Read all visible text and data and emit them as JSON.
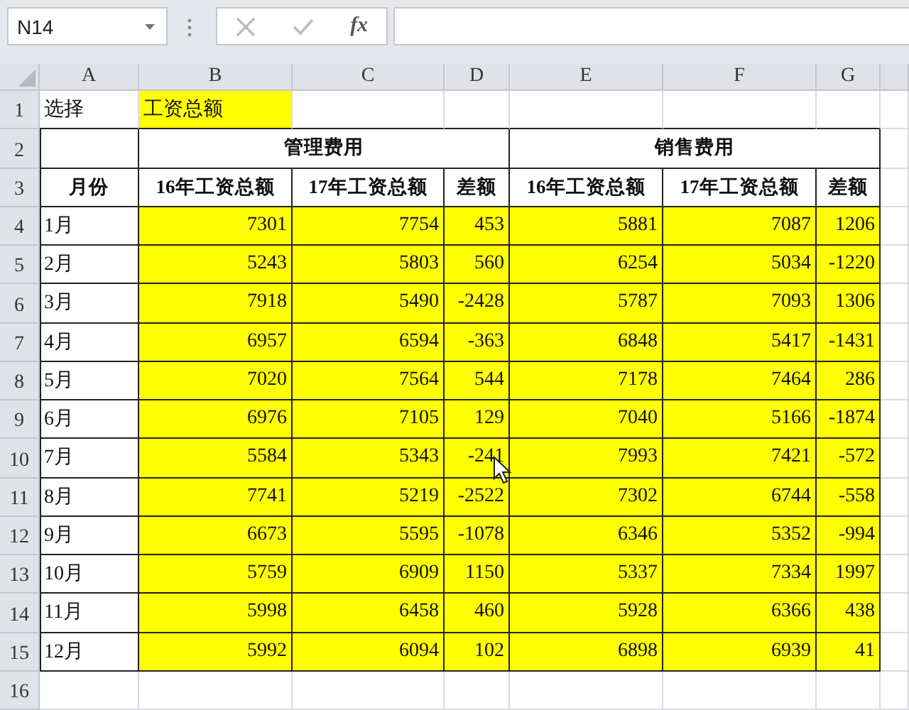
{
  "name_box": "N14",
  "formula_button": "fx",
  "columns": [
    "A",
    "B",
    "C",
    "D",
    "E",
    "F",
    "G"
  ],
  "row_numbers": [
    "1",
    "2",
    "3",
    "4",
    "5",
    "6",
    "7",
    "8",
    "9",
    "10",
    "11",
    "12",
    "13",
    "14",
    "15",
    "16"
  ],
  "select_label": "选择",
  "select_value": "工资总额",
  "groups": [
    "管理费用",
    "销售费用"
  ],
  "month_header": "月份",
  "subheaders": [
    "16年工资总额",
    "17年工资总额",
    "差额",
    "16年工资总额",
    "17年工资总额",
    "差额"
  ],
  "data_rows": [
    {
      "month": "1月",
      "values": [
        "7301",
        "7754",
        "453",
        "5881",
        "7087",
        "1206"
      ]
    },
    {
      "month": "2月",
      "values": [
        "5243",
        "5803",
        "560",
        "6254",
        "5034",
        "-1220"
      ]
    },
    {
      "month": "3月",
      "values": [
        "7918",
        "5490",
        "-2428",
        "5787",
        "7093",
        "1306"
      ]
    },
    {
      "month": "4月",
      "values": [
        "6957",
        "6594",
        "-363",
        "6848",
        "5417",
        "-1431"
      ]
    },
    {
      "month": "5月",
      "values": [
        "7020",
        "7564",
        "544",
        "7178",
        "7464",
        "286"
      ]
    },
    {
      "month": "6月",
      "values": [
        "6976",
        "7105",
        "129",
        "7040",
        "5166",
        "-1874"
      ]
    },
    {
      "month": "7月",
      "values": [
        "5584",
        "5343",
        "-241",
        "7993",
        "7421",
        "-572"
      ]
    },
    {
      "month": "8月",
      "values": [
        "7741",
        "5219",
        "-2522",
        "7302",
        "6744",
        "-558"
      ]
    },
    {
      "month": "9月",
      "values": [
        "6673",
        "5595",
        "-1078",
        "6346",
        "5352",
        "-994"
      ]
    },
    {
      "month": "10月",
      "values": [
        "5759",
        "6909",
        "1150",
        "5337",
        "7334",
        "1997"
      ]
    },
    {
      "month": "11月",
      "values": [
        "5998",
        "6458",
        "460",
        "5928",
        "6366",
        "438"
      ]
    },
    {
      "month": "12月",
      "values": [
        "5992",
        "6094",
        "102",
        "6898",
        "6939",
        "41"
      ]
    }
  ]
}
